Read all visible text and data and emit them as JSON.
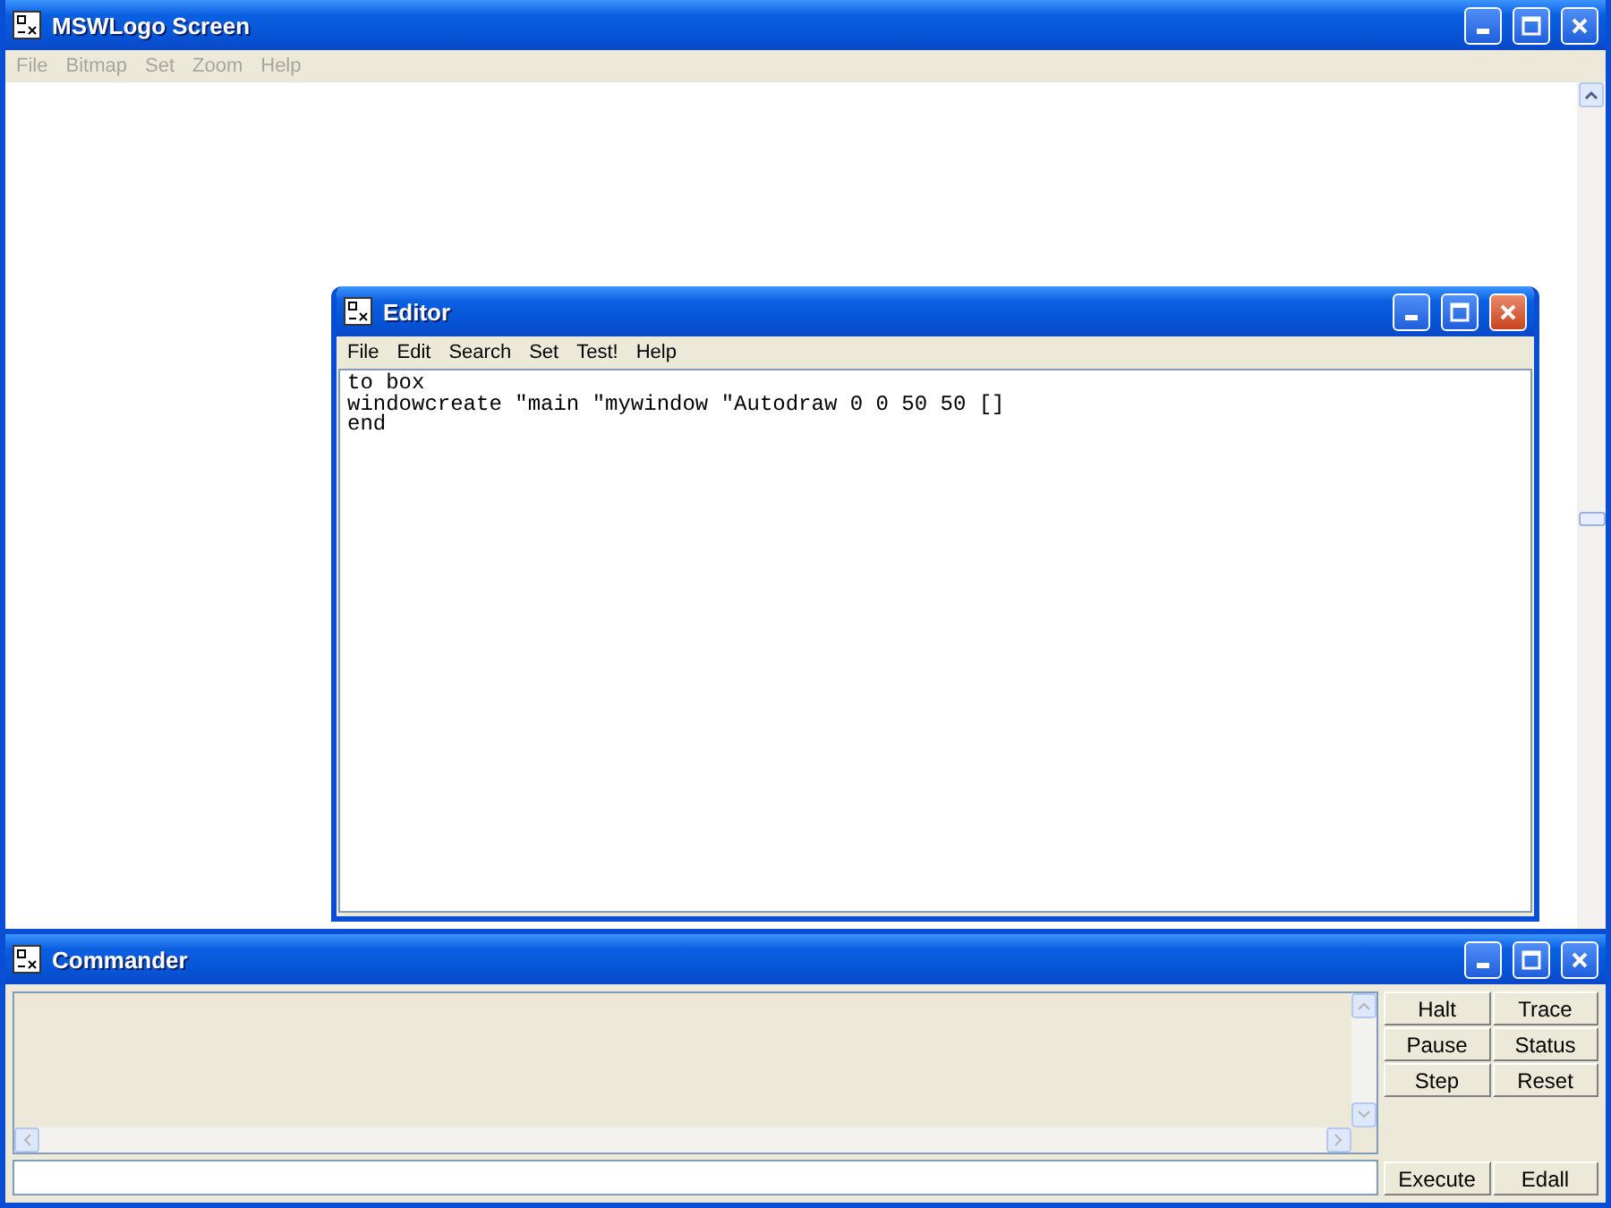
{
  "main_window": {
    "title": "MSWLogo Screen",
    "menu": [
      {
        "label": "File",
        "disabled": true
      },
      {
        "label": "Bitmap",
        "disabled": true
      },
      {
        "label": "Set",
        "disabled": true
      },
      {
        "label": "Zoom",
        "disabled": true
      },
      {
        "label": "Help",
        "disabled": true
      }
    ]
  },
  "editor": {
    "title": "Editor",
    "menu": [
      {
        "label": "File",
        "disabled": false
      },
      {
        "label": "Edit",
        "disabled": false
      },
      {
        "label": "Search",
        "disabled": false
      },
      {
        "label": "Set",
        "disabled": false
      },
      {
        "label": "Test!",
        "disabled": false
      },
      {
        "label": "Help",
        "disabled": false
      }
    ],
    "lines": [
      "to box",
      "windowcreate \"main \"mywindow \"Autodraw 0 0 50 50 []",
      "end"
    ]
  },
  "commander": {
    "title": "Commander",
    "buttons": [
      "Halt",
      "Trace",
      "Pause",
      "Status",
      "Step",
      "Reset"
    ],
    "bottom_buttons": [
      "Execute",
      "Edall"
    ]
  }
}
